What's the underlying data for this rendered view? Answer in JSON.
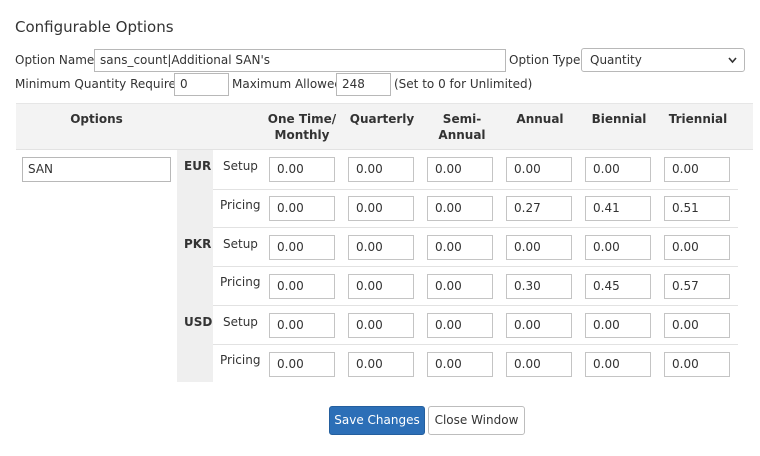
{
  "page_title": "Configurable Options",
  "option": {
    "name_label": "Option Name:",
    "name_value": "sans_count|Additional SAN's",
    "type_label": "Option Type:",
    "type_value": "Quantity",
    "min_label": "Minimum Quantity Required:",
    "min_value": "0",
    "max_label": "Maximum Allowed:",
    "max_value": "248",
    "max_hint": "(Set to 0 for Unlimited)"
  },
  "table": {
    "options_header": "Options",
    "columns": [
      {
        "line1": "One Time/",
        "line2": "Monthly"
      },
      {
        "line1": "Quarterly",
        "line2": ""
      },
      {
        "line1": "Semi-",
        "line2": "Annual"
      },
      {
        "line1": "Annual",
        "line2": ""
      },
      {
        "line1": "Biennial",
        "line2": ""
      },
      {
        "line1": "Triennial",
        "line2": ""
      }
    ],
    "sub_option_value": "SAN",
    "currencies": [
      {
        "code": "EUR",
        "setup_label": "Setup",
        "setup": [
          "0.00",
          "0.00",
          "0.00",
          "0.00",
          "0.00",
          "0.00"
        ],
        "pricing_label": "Pricing",
        "pricing": [
          "0.00",
          "0.00",
          "0.00",
          "0.27",
          "0.41",
          "0.51"
        ]
      },
      {
        "code": "PKR",
        "setup_label": "Setup",
        "setup": [
          "0.00",
          "0.00",
          "0.00",
          "0.00",
          "0.00",
          "0.00"
        ],
        "pricing_label": "Pricing",
        "pricing": [
          "0.00",
          "0.00",
          "0.00",
          "0.30",
          "0.45",
          "0.57"
        ]
      },
      {
        "code": "USD",
        "setup_label": "Setup",
        "setup": [
          "0.00",
          "0.00",
          "0.00",
          "0.00",
          "0.00",
          "0.00"
        ],
        "pricing_label": "Pricing",
        "pricing": [
          "0.00",
          "0.00",
          "0.00",
          "0.00",
          "0.00",
          "0.00"
        ]
      }
    ]
  },
  "buttons": {
    "save": "Save Changes",
    "close": "Close Window"
  }
}
